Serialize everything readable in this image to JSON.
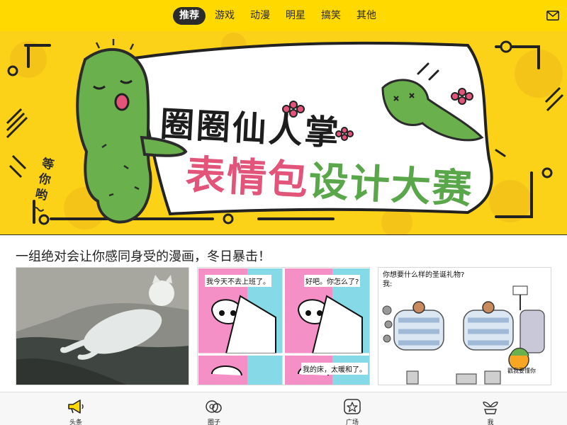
{
  "header": {
    "tabs": [
      {
        "label": "推荐",
        "active": true
      },
      {
        "label": "游戏",
        "active": false
      },
      {
        "label": "动漫",
        "active": false
      },
      {
        "label": "明星",
        "active": false
      },
      {
        "label": "搞笑",
        "active": false
      },
      {
        "label": "其他",
        "active": false
      }
    ],
    "mail_icon": "mail-icon",
    "bar_color": "#ffd900"
  },
  "banner": {
    "title_line1": "圈圈仙人掌",
    "title_line2a": "表情包",
    "title_line2b": "设计大赛",
    "side_text": "等你哟～",
    "background_color": "#fcd219"
  },
  "article": {
    "title": "一组绝对会让你感同身受的漫画，冬日暴击！",
    "thumbnails": [
      {
        "type": "photo",
        "subject": "cat"
      },
      {
        "type": "comic",
        "bubbles": [
          "我今天不去上班了。",
          "好吧。你怎么了?",
          "我的床，太暖和了。"
        ]
      },
      {
        "type": "comic",
        "question": "你想要什么样的圣诞礼物?",
        "answer": "我:",
        "caption": "戳我要懂你"
      }
    ]
  },
  "bottom_nav": {
    "items": [
      {
        "label": "头条",
        "icon": "megaphone-icon"
      },
      {
        "label": "圈子",
        "icon": "circles-icon"
      },
      {
        "label": "广场",
        "icon": "star-icon"
      },
      {
        "label": "我",
        "icon": "sprout-icon"
      }
    ]
  }
}
